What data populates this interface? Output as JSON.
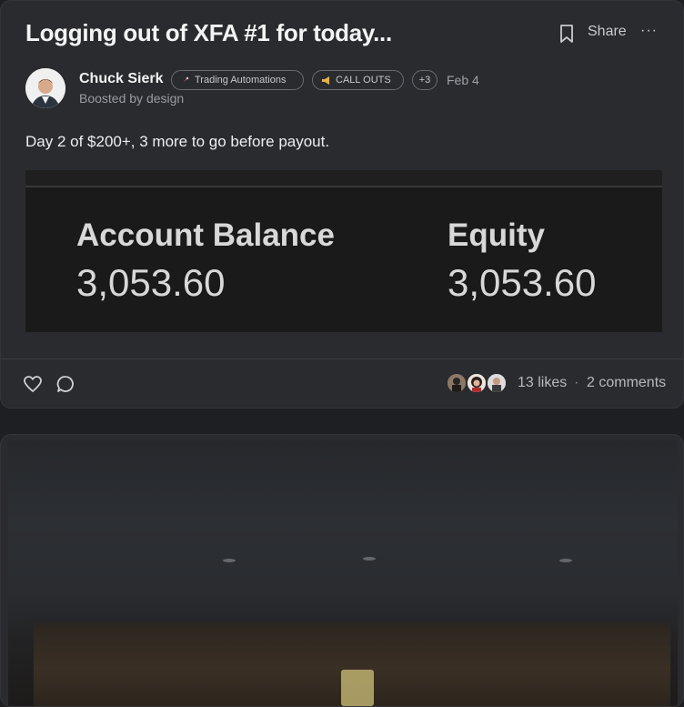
{
  "post": {
    "title": "Logging out of XFA #1 for today...",
    "share_label": "Share",
    "more_label": "···",
    "author": {
      "name": "Chuck Sierk",
      "boosted_by": "Boosted by design"
    },
    "tags": [
      {
        "icon": "rocket-icon",
        "label": "Trading Automations"
      },
      {
        "icon": "megaphone-icon",
        "label": "CALL OUTS"
      },
      {
        "label": "+3"
      }
    ],
    "date": "Feb 4",
    "body": "Day 2 of $200+, 3 more to go before payout.",
    "image": {
      "account_balance_label": "Account Balance",
      "account_balance_value": "3,053.60",
      "equity_label": "Equity",
      "equity_value": "3,053.60"
    },
    "footer": {
      "likes": "13 likes",
      "separator": "·",
      "comments": "2 comments"
    }
  },
  "colors": {
    "background": "#1e1f22",
    "card": "#2a2b2f",
    "text_primary": "#f4f4f5",
    "text_muted": "#9a9ba0"
  }
}
